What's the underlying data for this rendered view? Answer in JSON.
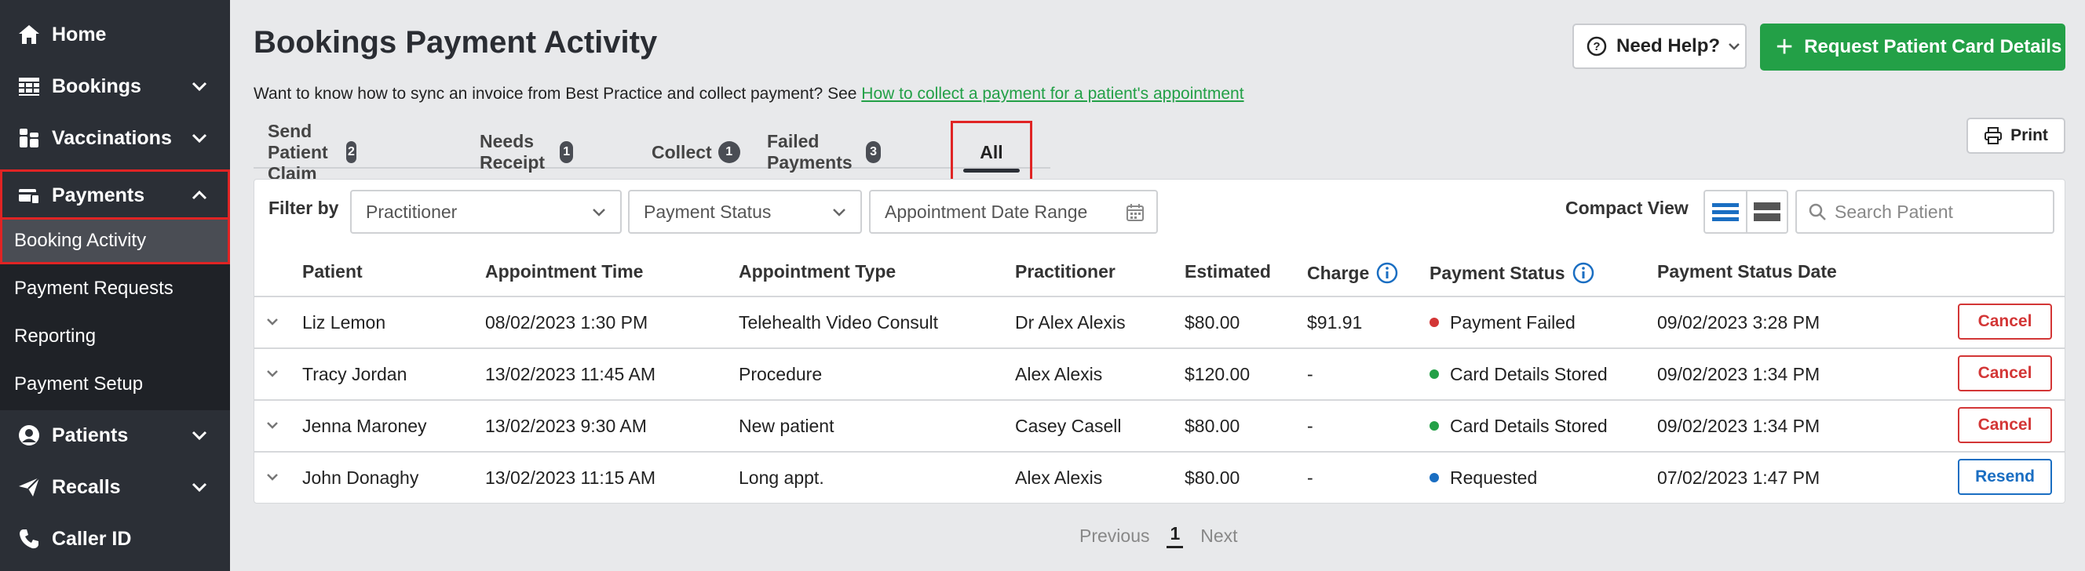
{
  "sidebar": {
    "items": [
      {
        "label": "Home",
        "icon": "home-icon"
      },
      {
        "label": "Bookings",
        "icon": "calendar-grid-icon"
      },
      {
        "label": "Vaccinations",
        "icon": "vials-icon"
      },
      {
        "label": "Payments",
        "icon": "payment-card-icon"
      },
      {
        "label": "Patients",
        "icon": "user-circle-icon"
      },
      {
        "label": "Recalls",
        "icon": "paper-plane-icon"
      },
      {
        "label": "Caller ID",
        "icon": "phone-icon"
      }
    ],
    "payments_sub": [
      "Booking Activity",
      "Payment Requests",
      "Reporting",
      "Payment Setup"
    ]
  },
  "header": {
    "title": "Bookings Payment Activity",
    "help_label": "Need Help?",
    "request_label": "Request Patient Card Details",
    "info_text": "Want to know how to sync an invoice from Best Practice and collect payment? See",
    "info_link": "How to collect a payment for a patient's appointment"
  },
  "tabs": [
    {
      "label": "Send Patient Claim",
      "count": "2"
    },
    {
      "label": "Needs Receipt",
      "count": "1"
    },
    {
      "label": "Collect",
      "count": "1"
    },
    {
      "label": "Failed Payments",
      "count": "3"
    },
    {
      "label": "All"
    }
  ],
  "print_label": "Print",
  "filters": {
    "label": "Filter by",
    "practitioner": "Practitioner",
    "payment_status": "Payment Status",
    "date_range": "Appointment Date Range",
    "compact_view": "Compact View",
    "search_placeholder": "Search Patient"
  },
  "table": {
    "columns": [
      "Patient",
      "Appointment Time",
      "Appointment Type",
      "Practitioner",
      "Estimated",
      "Charge",
      "Payment Status",
      "Payment Status Date"
    ],
    "rows": [
      {
        "patient": "Liz Lemon",
        "time": "08/02/2023 1:30 PM",
        "type": "Telehealth Video Consult",
        "practitioner": "Dr Alex Alexis",
        "estimated": "$80.00",
        "charge": "$91.91",
        "status": "Payment Failed",
        "status_color": "#d33636",
        "status_date": "09/02/2023 3:28 PM",
        "action": "Cancel"
      },
      {
        "patient": "Tracy Jordan",
        "time": "13/02/2023 11:45 AM",
        "type": "Procedure",
        "practitioner": "Alex Alexis",
        "estimated": "$120.00",
        "charge": "-",
        "status": "Card Details Stored",
        "status_color": "#23a047",
        "status_date": "09/02/2023 1:34 PM",
        "action": "Cancel"
      },
      {
        "patient": "Jenna Maroney",
        "time": "13/02/2023 9:30 AM",
        "type": "New patient",
        "practitioner": "Casey Casell",
        "estimated": "$80.00",
        "charge": "-",
        "status": "Card Details Stored",
        "status_color": "#23a047",
        "status_date": "09/02/2023 1:34 PM",
        "action": "Cancel"
      },
      {
        "patient": "John Donaghy",
        "time": "13/02/2023 11:15 AM",
        "type": "Long appt.",
        "practitioner": "Alex Alexis",
        "estimated": "$80.00",
        "charge": "-",
        "status": "Requested",
        "status_color": "#1a6ec2",
        "status_date": "07/02/2023 1:47 PM",
        "action": "Resend"
      }
    ]
  },
  "pagination": {
    "previous": "Previous",
    "page": "1",
    "next": "Next"
  },
  "colors": {
    "sidebar": "#2b2f36",
    "accent_green": "#23a047",
    "highlight_red": "#e02424",
    "link_blue": "#1a6ec2"
  }
}
